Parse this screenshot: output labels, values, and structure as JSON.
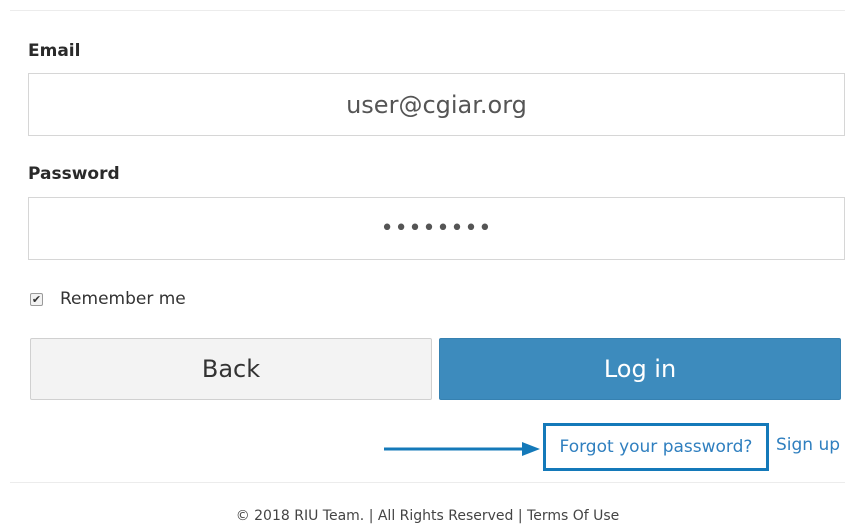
{
  "form": {
    "email": {
      "label": "Email",
      "value": "user@cgiar.org"
    },
    "password": {
      "label": "Password",
      "value": "••••••••"
    },
    "remember": {
      "label": "Remember me",
      "checked": true,
      "check_glyph": "✔"
    },
    "back_label": "Back",
    "login_label": "Log in"
  },
  "links": {
    "forgot": "Forgot your password?",
    "signup": "Sign up"
  },
  "footer": {
    "text": "© 2018 RIU Team. | All Rights Reserved | Terms Of Use"
  },
  "colors": {
    "accent": "#3d8bbd",
    "link": "#2f7fbf",
    "highlight": "#1479b9"
  },
  "icons": {
    "annotation_arrow": "arrow-right-icon",
    "checkbox": "checkmark-icon"
  }
}
